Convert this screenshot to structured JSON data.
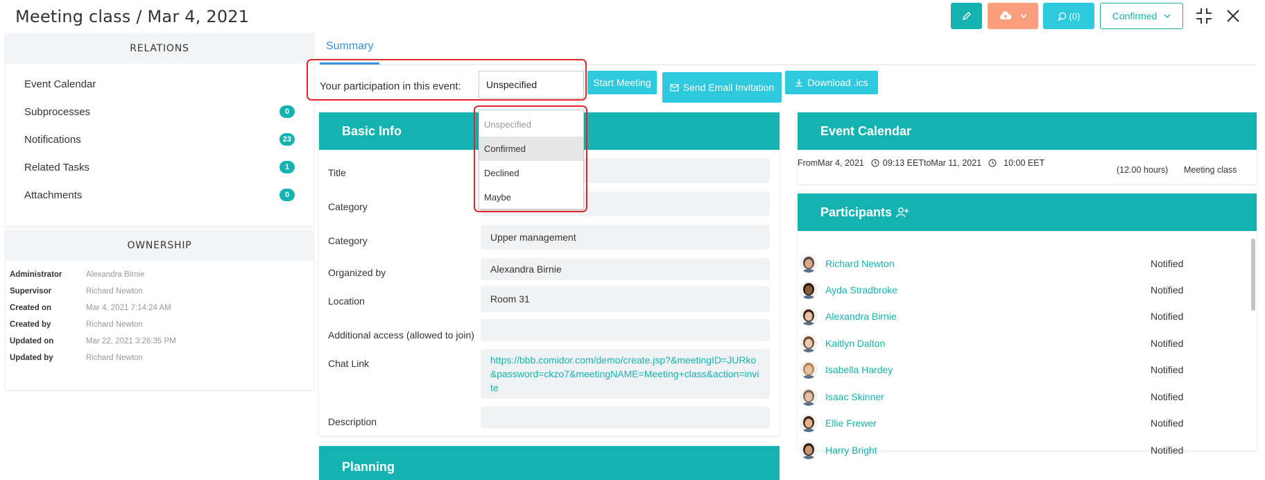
{
  "header": {
    "title": "Meeting class / Mar 4, 2021",
    "comments_label": "(0)",
    "status_label": "Confirmed"
  },
  "relations": {
    "heading": "RELATIONS",
    "items": [
      {
        "label": "Event Calendar",
        "count": ""
      },
      {
        "label": "Subprocesses",
        "count": "0"
      },
      {
        "label": "Notifications",
        "count": "23"
      },
      {
        "label": "Related Tasks",
        "count": "1"
      },
      {
        "label": "Attachments",
        "count": "0"
      }
    ]
  },
  "ownership": {
    "heading": "OWNERSHIP",
    "rows": [
      {
        "key": "Administrator",
        "value": "Alexandra Birnie"
      },
      {
        "key": "Supervisor",
        "value": "Richard Newton"
      },
      {
        "key": "Created on",
        "value": "Mar 4, 2021 7:14:24 AM"
      },
      {
        "key": "Created by",
        "value": "Richard Newton"
      },
      {
        "key": "Updated on",
        "value": "Mar 22, 2021 3:26:35 PM"
      },
      {
        "key": "Updated by",
        "value": "Richard Newton"
      }
    ]
  },
  "tabs": {
    "summary": "Summary"
  },
  "participation": {
    "label": "Your participation in this event:",
    "selected": "Unspecified",
    "options": [
      "Unspecified",
      "Confirmed",
      "Declined",
      "Maybe"
    ],
    "highlighted": "Confirmed"
  },
  "actions": {
    "start_meeting": "Start Meeting",
    "send_email": "Send Email Invitation",
    "download_ics": "Download .ics"
  },
  "basic_info": {
    "heading": "Basic Info",
    "fields": [
      {
        "label": "Title",
        "value": ""
      },
      {
        "label": "Category",
        "value": ""
      },
      {
        "label": "Category",
        "value": "Upper management"
      },
      {
        "label": "Organized by",
        "value": "Alexandra Birnie"
      },
      {
        "label": "Location",
        "value": "Room 31"
      },
      {
        "label": "Additional access (allowed to join)",
        "value": ""
      },
      {
        "label": "Chat Link",
        "value": "https://bbb.comidor.com/demo/create.jsp?&meetingID=JURko&password=ckzo7&meetingNAME=Meeting+class&action=invite"
      },
      {
        "label": "Description",
        "value": ""
      }
    ]
  },
  "planning": {
    "heading": "Planning"
  },
  "event_calendar": {
    "heading": "Event Calendar",
    "from_label": "From",
    "from_date": "Mar 4, 2021",
    "from_time": "09:13 EET",
    "to_label": "to",
    "to_date": "Mar 11, 2021",
    "to_time": "10:00 EET",
    "duration": "(12.00 hours)",
    "name": "Meeting class"
  },
  "participants": {
    "heading": "Participants",
    "items": [
      {
        "name": "Richard Newton",
        "status": "Notified",
        "skin": "#d9a98a",
        "hair": "#5b4a3f"
      },
      {
        "name": "Ayda Stradbroke",
        "status": "Notified",
        "skin": "#8a5a3c",
        "hair": "#2a1a12"
      },
      {
        "name": "Alexandra Birnie",
        "status": "Notified",
        "skin": "#e9c2a5",
        "hair": "#3d2416"
      },
      {
        "name": "Kaitlyn Dalton",
        "status": "Notified",
        "skin": "#eac9b0",
        "hair": "#6b4a32"
      },
      {
        "name": "Isabella Hardey",
        "status": "Notified",
        "skin": "#e6bf9f",
        "hair": "#b6834f"
      },
      {
        "name": "Isaac Skinner",
        "status": "Notified",
        "skin": "#e8c0a3",
        "hair": "#7a6a5a"
      },
      {
        "name": "Ellie Frewer",
        "status": "Notified",
        "skin": "#e3b48e",
        "hair": "#3a2314"
      },
      {
        "name": "Harry Bright",
        "status": "Notified",
        "skin": "#c99673",
        "hair": "#2b2118"
      }
    ]
  },
  "colors": {
    "accent": "#14b2b0",
    "cyan": "#2fc9de",
    "orange": "#fa9f7d",
    "link": "#3a8fd8",
    "highlight_border": "#e0262d"
  }
}
